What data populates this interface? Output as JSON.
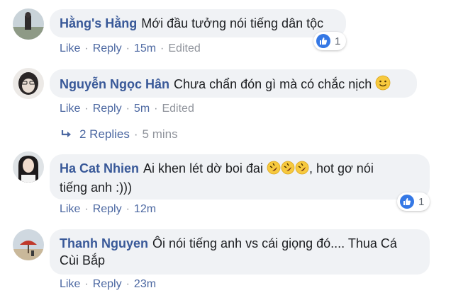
{
  "comments": [
    {
      "name": "Hằng's Hằng",
      "text": "Mới đầu tưởng nói tiếng dân tộc",
      "actions": {
        "like": "Like",
        "reply": "Reply",
        "time": "15m",
        "edited": "Edited"
      },
      "reactions": "1"
    },
    {
      "name": "Nguyễn Ngọc Hân",
      "text": "Chưa chẩn đón gì mà có chắc nịch",
      "emoji": "slightly-smiling-face",
      "actions": {
        "like": "Like",
        "reply": "Reply",
        "time": "5m",
        "edited": "Edited"
      }
    },
    {
      "name": "Ha Cat Nhien",
      "text_line1": "Ai khen lét dờ boi đai",
      "text_line1_end": ", hot gơ nói",
      "text_line2": "tiếng anh :)))",
      "emoji": "rolling-on-floor-laughing",
      "actions": {
        "like": "Like",
        "reply": "Reply",
        "time": "12m"
      },
      "reactions": "1"
    },
    {
      "name": "Thanh Nguyen",
      "text_line1": "Ôi nói tiếng anh vs cái giọng đó.... Thua Cá",
      "text_line2": "Cùi Bắp",
      "actions": {
        "like": "Like",
        "reply": "Reply",
        "time": "23m"
      }
    }
  ],
  "replies": {
    "label": "2 Replies",
    "time": "5 mins"
  },
  "colors": {
    "name": "#385898",
    "link": "#4b67a1",
    "meta": "#90949c",
    "bubble": "#f0f2f5",
    "like_badge": "#3578e5"
  }
}
